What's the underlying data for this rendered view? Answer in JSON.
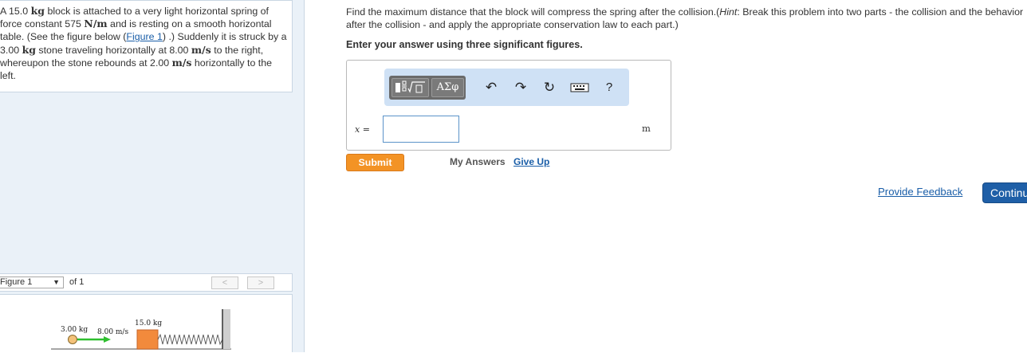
{
  "problem": {
    "text_1": "A 15.0 ",
    "unit_kg": "kg",
    "text_2": " block is attached to a very light horizontal spring of force constant 575 ",
    "unit_Nm": "N/m",
    "text_3": " and is resting on a smooth horizontal table. (See the figure below (",
    "figure_link": "Figure 1",
    "text_4": ") .) Suddenly it is struck by a 3.00 ",
    "text_5": " stone traveling horizontally at 8.00 ",
    "unit_ms": "m/s",
    "text_6": " to the right, whereupon the stone rebounds at 2.00 ",
    "text_7": " horizontally to the left."
  },
  "figure_nav": {
    "select_value": "Figure 1",
    "of_label": "of 1",
    "prev_label": "<",
    "next_label": ">"
  },
  "figure": {
    "stone_mass": "3.00 kg",
    "stone_speed": "8.00 m/s",
    "block_mass": "15.0 kg",
    "stone_color": "#f3c27a",
    "arrow_color": "#2fbf2f",
    "block_color": "#f28a3c"
  },
  "question": {
    "text": "Find the maximum distance that the block will compress the spring after the collision.(",
    "hint_label": "Hint",
    "hint_text": ": Break this problem into two parts - the collision and the behavior after the collision - and apply the appropriate conservation law to each part.)"
  },
  "instruction": "Enter your answer using three significant figures.",
  "toolbar": {
    "template_icon": "fraction-radical-template-icon",
    "greek_label": "ΑΣφ",
    "undo_icon": "undo-icon",
    "redo_icon": "redo-icon",
    "reset_icon": "reset-icon",
    "keyboard_icon": "keyboard-icon",
    "help_label": "?"
  },
  "answer": {
    "var_label": "x",
    "equals": " =",
    "value": "",
    "unit": "m"
  },
  "actions": {
    "submit": "Submit",
    "my_answers": "My Answers",
    "give_up": "Give Up",
    "feedback": "Provide Feedback",
    "continue": "Continue"
  }
}
